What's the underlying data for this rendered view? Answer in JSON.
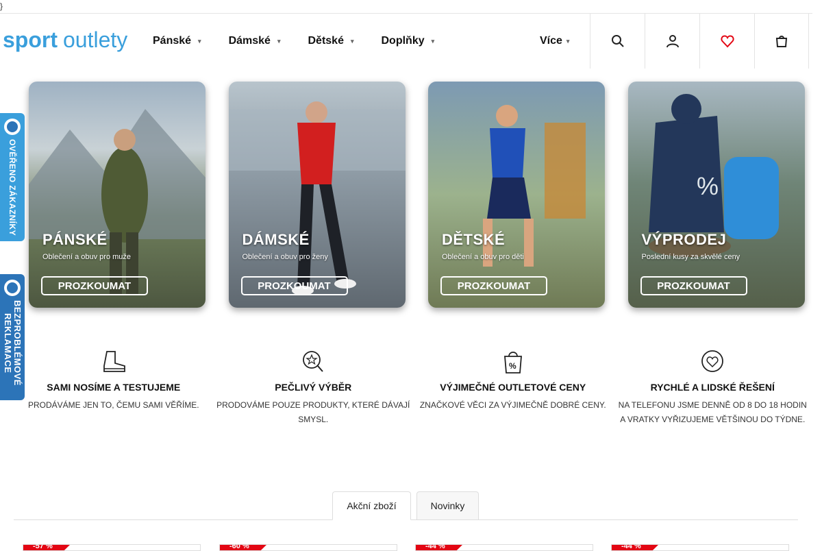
{
  "stray_text": "}",
  "logo": {
    "part1": "sport",
    "part2": "outlety"
  },
  "nav": {
    "items": [
      {
        "label": "Pánské"
      },
      {
        "label": "Dámské"
      },
      {
        "label": "Dětské"
      },
      {
        "label": "Doplňky"
      }
    ],
    "more_label": "Více"
  },
  "header_icons": [
    "search-icon",
    "user-icon",
    "heart-icon",
    "cart-icon"
  ],
  "banners": [
    {
      "title": "PÁNSKÉ",
      "subtitle": "Oblečení a obuv pro muže",
      "cta": "PROZKOUMAT"
    },
    {
      "title": "DÁMSKÉ",
      "subtitle": "Oblečení a obuv pro ženy",
      "cta": "PROZKOUMAT"
    },
    {
      "title": "DĚTSKÉ",
      "subtitle": "Oblečení a obuv pro děti",
      "cta": "PROZKOUMAT"
    },
    {
      "title": "VÝPRODEJ",
      "subtitle": "Poslední kusy za skvělé ceny",
      "cta": "PROZKOUMAT"
    }
  ],
  "side_badges": {
    "verified": "OVĚŘENO ZÁKAZNÍKY",
    "complaints_line1": "BEZPROBLÉMOVÉ",
    "complaints_line2": "REKLAMACE"
  },
  "features": [
    {
      "icon": "boot-icon",
      "title": "SAMI NOSÍME A TESTUJEME",
      "text": "PRODÁVÁME JEN TO, ČEMU SAMI VĚŘÍME."
    },
    {
      "icon": "magnifier-star-icon",
      "title": "PEČLIVÝ VÝBĚR",
      "text": "PRODOVÁME POUZE PRODUKTY, KTERÉ DÁVAJÍ SMYSL."
    },
    {
      "icon": "shopping-bag-percent-icon",
      "title": "VÝJIMEČNÉ OUTLETOVÉ CENY",
      "text": "ZNAČKOVÉ VĚCI ZA VÝJIMEČNĚ DOBRÉ CENY."
    },
    {
      "icon": "heart-chat-icon",
      "title": "RYCHLÉ A LIDSKÉ ŘEŠENÍ",
      "text": "NA TELEFONU JSME DENNĚ OD 8 DO 18 HODIN A VRATKY VYŘIZUJEME VĚTŠINOU DO TÝDNE."
    }
  ],
  "tabs": {
    "sale": "Akční zboží",
    "new": "Novinky"
  },
  "products": [
    {
      "discount": "-57 %"
    },
    {
      "discount": "-60 %"
    },
    {
      "discount": "-44 %"
    },
    {
      "discount": "-44 %"
    }
  ],
  "colors": {
    "brand_blue": "#3a9fdc",
    "sale_red": "#e30613"
  }
}
